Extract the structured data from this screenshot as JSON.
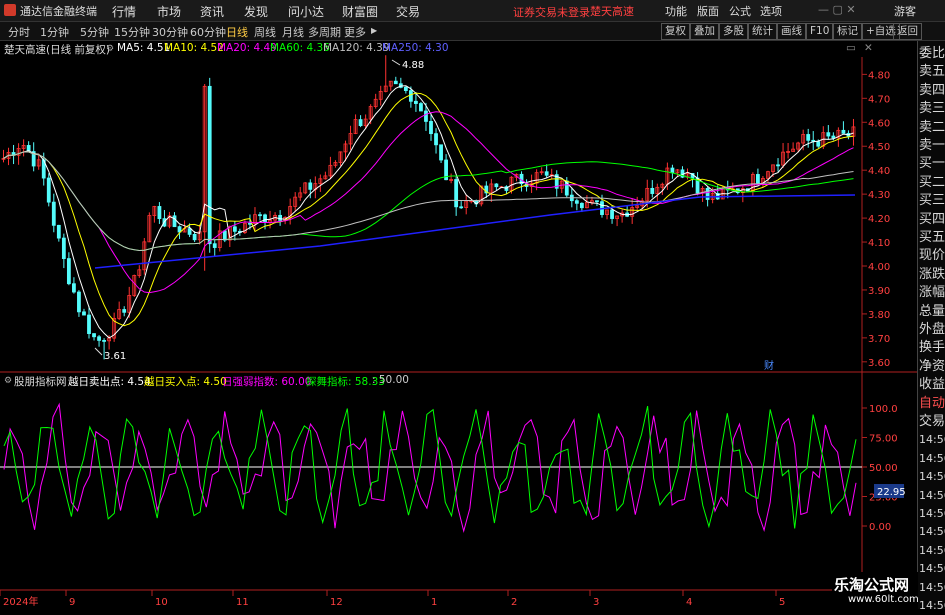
{
  "app": {
    "name": "通达信金融终端",
    "menu": [
      "行情",
      "市场",
      "资讯",
      "发现",
      "问小达",
      "财富圈",
      "交易"
    ],
    "notice": "证券交易未登录",
    "stock_name": "楚天高速",
    "right_menu": [
      "功能",
      "版面",
      "公式",
      "选项"
    ],
    "guest": "游客"
  },
  "toolbar": {
    "period_tabs": [
      "分时",
      "1分钟",
      "5分钟",
      "15分钟",
      "30分钟",
      "60分钟",
      "日线",
      "周线",
      "月线",
      "多周期",
      "更多"
    ],
    "active_tab": "日线",
    "buttons": [
      "复权",
      "叠加",
      "多股",
      "统计",
      "画线",
      "F10",
      "标记",
      "+自选",
      "返回"
    ]
  },
  "main_chart": {
    "title": "楚天高速(日线 前复权)",
    "ma_labels": [
      {
        "text": "MA5: 4.51",
        "color": "#ffffff"
      },
      {
        "text": "MA10: 4.52",
        "color": "#ffff00"
      },
      {
        "text": "MA20: 4.49",
        "color": "#ff00ff"
      },
      {
        "text": "MA60: 4.36",
        "color": "#00ff00"
      },
      {
        "text": "MA120: 4.39",
        "color": "#c0c0c0"
      },
      {
        "text": "MA250: 4.30",
        "color": "#5050ff"
      }
    ],
    "price_ticks": [
      "4.80",
      "4.70",
      "4.60",
      "4.50",
      "4.40",
      "4.30",
      "4.20",
      "4.10",
      "4.00",
      "3.90",
      "3.80",
      "3.70",
      "3.60"
    ],
    "high_label": "4.88",
    "low_label": "3.61",
    "event_marker": "财"
  },
  "indicator": {
    "name": "股朋指标网",
    "items": [
      {
        "text": "越日卖出点: 4.54",
        "color": "#ffffff"
      },
      {
        "text": "越日买入点: 4.50",
        "color": "#ffff00"
      },
      {
        "text": "日强弱指数: 60.00",
        "color": "#ff00ff"
      },
      {
        "text": "探舞指标: 58.33",
        "color": "#00ff00"
      },
      {
        "text": ": 50.00",
        "color": "#cccccc"
      }
    ],
    "ticks": [
      "100.0",
      "75.00",
      "50.00",
      "25.00",
      "0.00"
    ],
    "current_value": "22.95"
  },
  "time_axis": [
    "2024年",
    "9",
    "10",
    "11",
    "12",
    "1",
    "2",
    "3",
    "4",
    "5"
  ],
  "side_panel": [
    "委比",
    "卖五",
    "卖四",
    "卖三",
    "卖二",
    "卖一",
    "买一",
    "买二",
    "买三",
    "买四",
    "买五",
    "现价",
    "涨跌",
    "涨幅",
    "总量",
    "外盘",
    "换手",
    "净资",
    "收益",
    "自动",
    "交易",
    "14:56",
    "14:56",
    "14:56",
    "14:56",
    "14:56",
    "14:56",
    "14:56",
    "14:56",
    "14:56",
    "14:56"
  ],
  "watermark": {
    "title": "乐淘公式网",
    "url": "www.60lt.com"
  },
  "colors": {
    "up": "#ff3232",
    "down": "#54fcfc",
    "ma5": "#ffffff",
    "ma10": "#ffff00",
    "ma20": "#ff00ff",
    "ma60": "#00ff00",
    "ma120": "#c0c0c0",
    "ma250": "#2020ff",
    "osc1": "#ff00ff",
    "osc2": "#00ff00"
  }
}
